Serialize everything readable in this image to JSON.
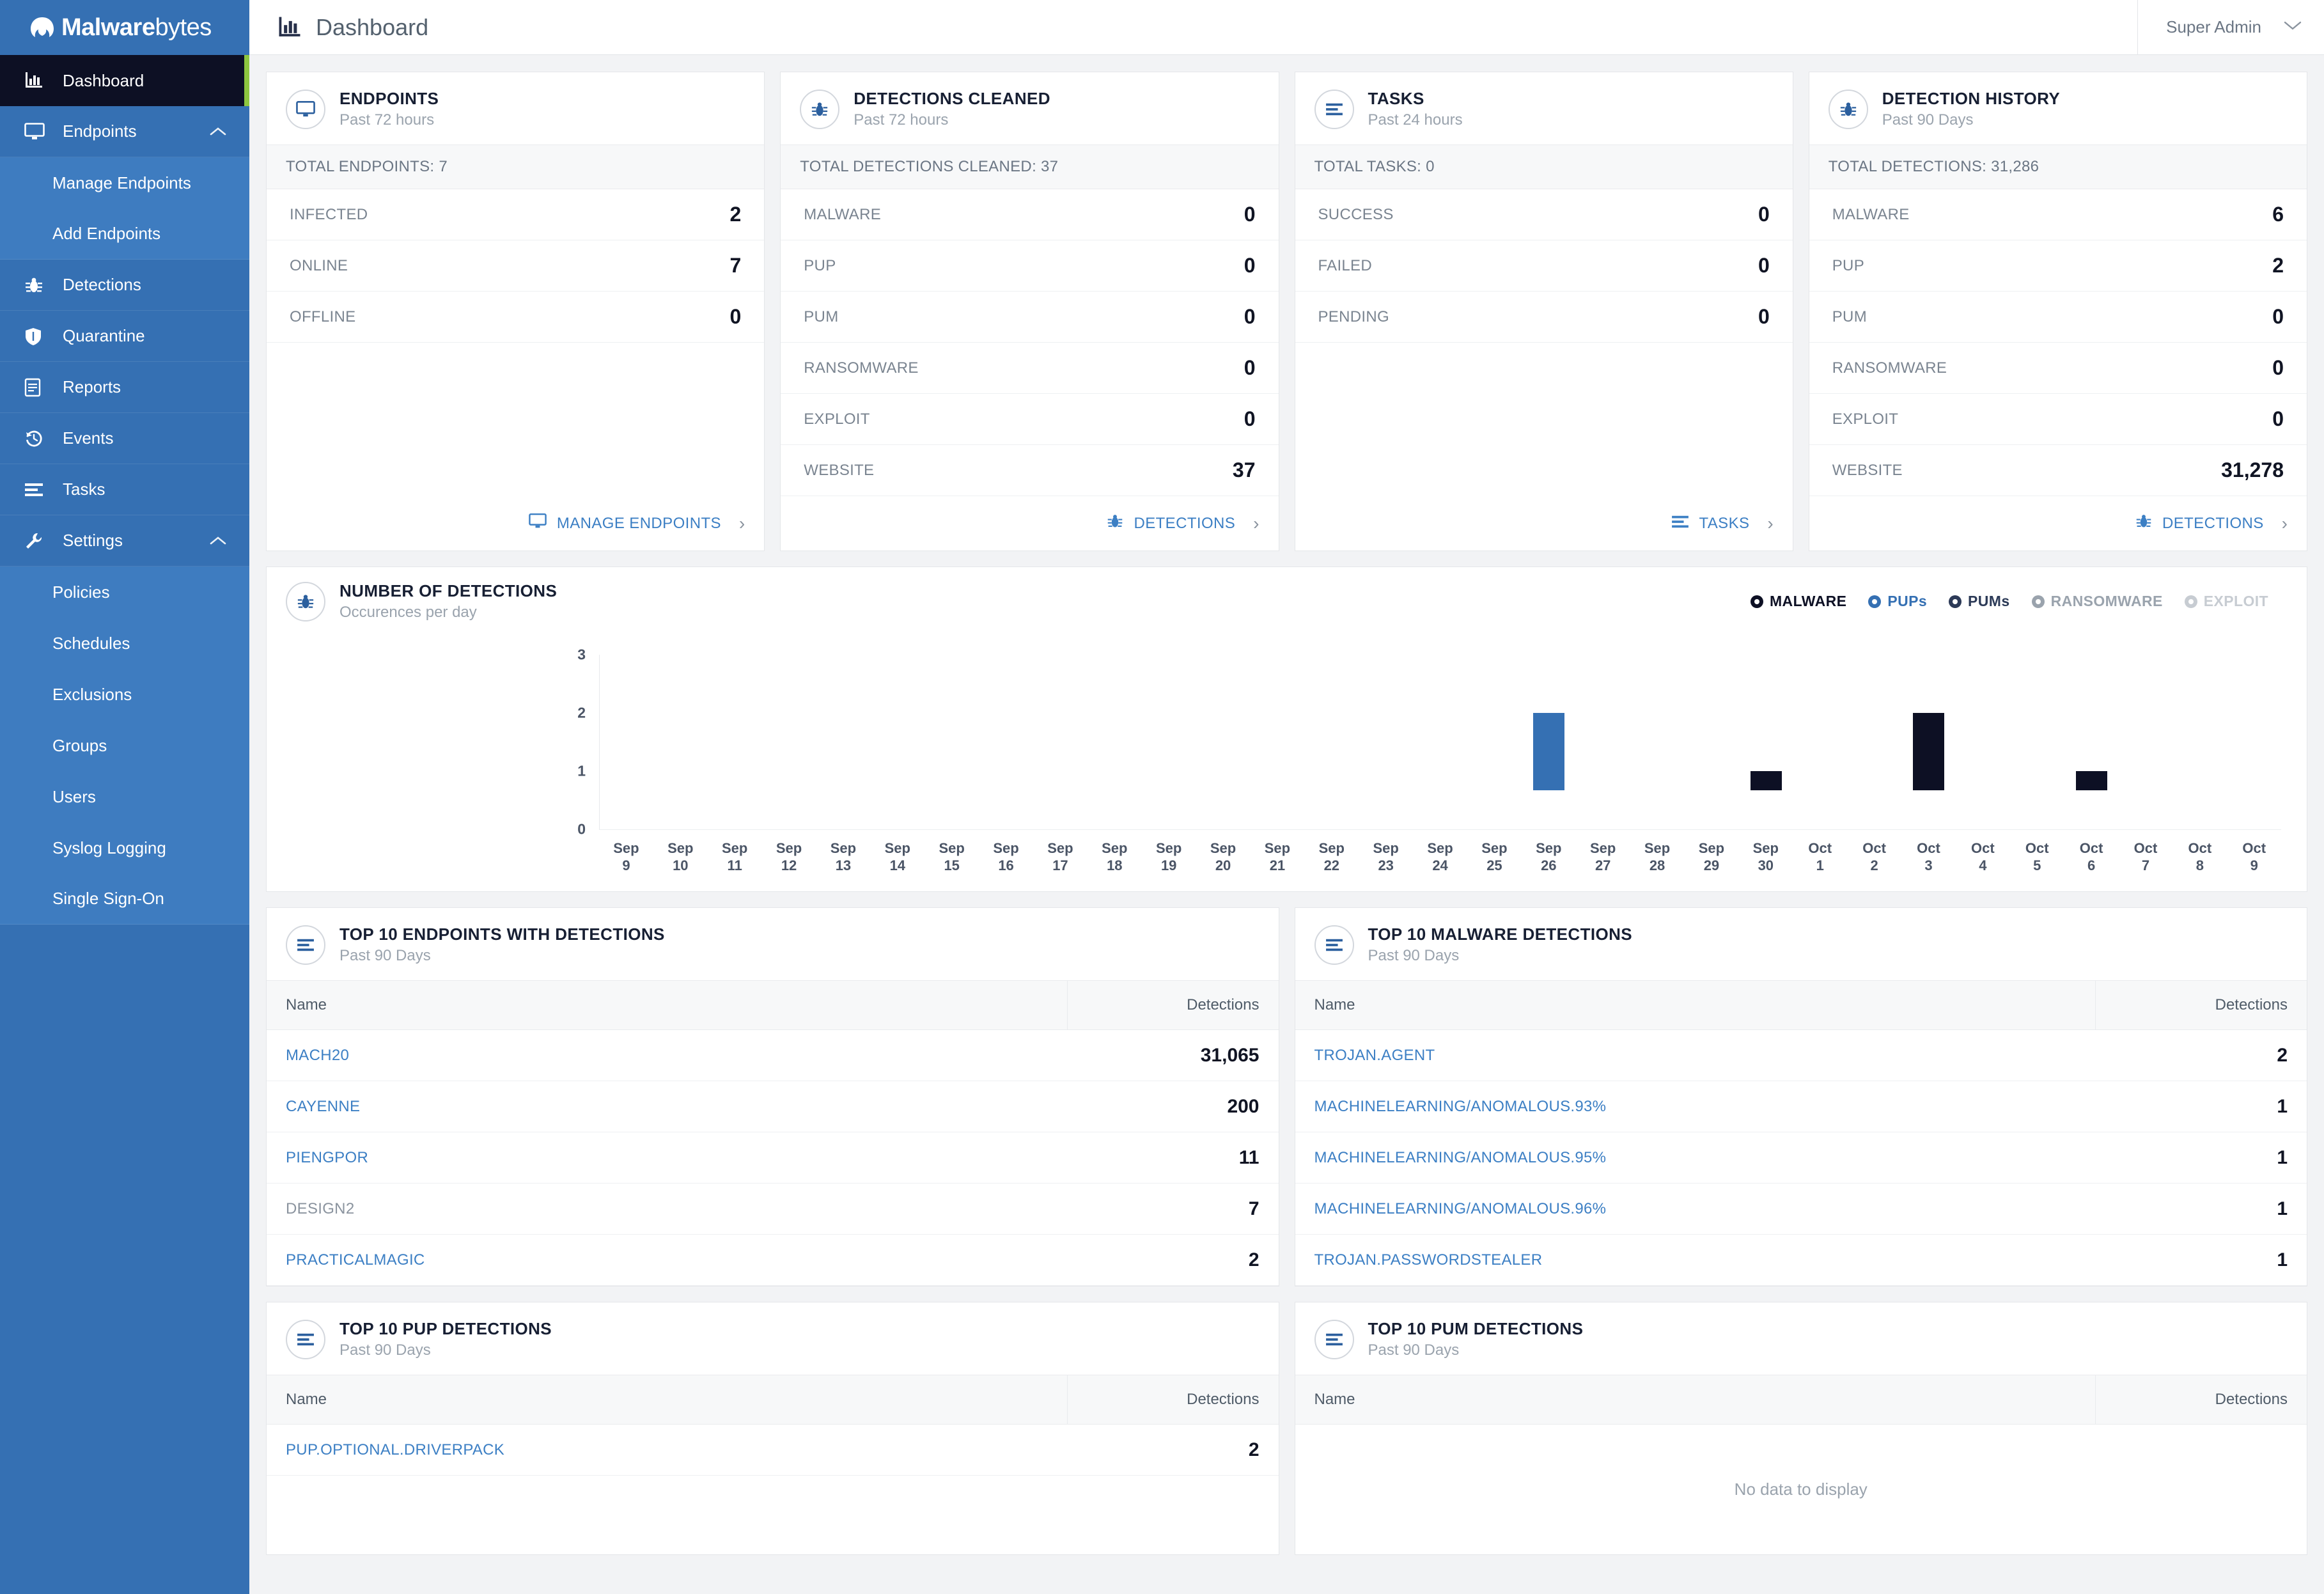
{
  "brand": {
    "name_bold": "Malware",
    "name_light": "bytes"
  },
  "sidebar": {
    "items": [
      {
        "label": "Dashboard",
        "icon": "bar-chart-icon",
        "active": true
      },
      {
        "label": "Endpoints",
        "icon": "monitor-icon",
        "expandable": true
      },
      {
        "label": "Manage Endpoints",
        "sub": true
      },
      {
        "label": "Add Endpoints",
        "sub": true
      },
      {
        "label": "Detections",
        "icon": "bug-icon"
      },
      {
        "label": "Quarantine",
        "icon": "shield-icon"
      },
      {
        "label": "Reports",
        "icon": "document-icon"
      },
      {
        "label": "Events",
        "icon": "history-icon"
      },
      {
        "label": "Tasks",
        "icon": "list-icon"
      },
      {
        "label": "Settings",
        "icon": "wrench-icon",
        "expandable": true
      },
      {
        "label": "Policies",
        "sub": true
      },
      {
        "label": "Schedules",
        "sub": true
      },
      {
        "label": "Exclusions",
        "sub": true
      },
      {
        "label": "Groups",
        "sub": true
      },
      {
        "label": "Users",
        "sub": true
      },
      {
        "label": "Syslog Logging",
        "sub": true
      },
      {
        "label": "Single Sign-On",
        "sub": true
      }
    ]
  },
  "topbar": {
    "title": "Dashboard",
    "title_icon": "bar-chart-icon",
    "user": "Super Admin",
    "user_chevron": "chevron-down-icon"
  },
  "cards": [
    {
      "title": "ENDPOINTS",
      "subtitle": "Past 72 hours",
      "icon": "monitor-icon",
      "total": "TOTAL ENDPOINTS: 7",
      "rows": [
        {
          "label": "INFECTED",
          "value": "2"
        },
        {
          "label": "ONLINE",
          "value": "7"
        },
        {
          "label": "OFFLINE",
          "value": "0"
        }
      ],
      "footer_label": "MANAGE ENDPOINTS",
      "footer_icon": "monitor-icon"
    },
    {
      "title": "DETECTIONS CLEANED",
      "subtitle": "Past 72 hours",
      "icon": "bug-icon",
      "total": "TOTAL DETECTIONS CLEANED: 37",
      "rows": [
        {
          "label": "MALWARE",
          "value": "0"
        },
        {
          "label": "PUP",
          "value": "0"
        },
        {
          "label": "PUM",
          "value": "0"
        },
        {
          "label": "RANSOMWARE",
          "value": "0"
        },
        {
          "label": "EXPLOIT",
          "value": "0"
        },
        {
          "label": "WEBSITE",
          "value": "37"
        }
      ],
      "footer_label": "DETECTIONS",
      "footer_icon": "bug-icon"
    },
    {
      "title": "TASKS",
      "subtitle": "Past 24 hours",
      "icon": "list-icon",
      "total": "TOTAL TASKS: 0",
      "rows": [
        {
          "label": "SUCCESS",
          "value": "0"
        },
        {
          "label": "FAILED",
          "value": "0"
        },
        {
          "label": "PENDING",
          "value": "0"
        }
      ],
      "footer_label": "TASKS",
      "footer_icon": "list-icon"
    },
    {
      "title": "DETECTION HISTORY",
      "subtitle": "Past 90 Days",
      "icon": "bug-icon",
      "total": "TOTAL DETECTIONS: 31,286",
      "rows": [
        {
          "label": "MALWARE",
          "value": "6"
        },
        {
          "label": "PUP",
          "value": "2"
        },
        {
          "label": "PUM",
          "value": "0"
        },
        {
          "label": "RANSOMWARE",
          "value": "0"
        },
        {
          "label": "EXPLOIT",
          "value": "0"
        },
        {
          "label": "WEBSITE",
          "value": "31,278"
        }
      ],
      "footer_label": "DETECTIONS",
      "footer_icon": "bug-icon"
    }
  ],
  "chart_panel": {
    "title": "NUMBER OF DETECTIONS",
    "subtitle": "Occurences per day",
    "icon": "bug-icon"
  },
  "chart_data": {
    "type": "bar",
    "title": "NUMBER OF DETECTIONS",
    "subtitle": "Occurences per day",
    "xlabel": "",
    "ylabel": "",
    "ylim": [
      0,
      3
    ],
    "yticks": [
      "0",
      "1",
      "2",
      "3"
    ],
    "grid": false,
    "legend_position": "top-right",
    "legend": [
      {
        "name": "MALWARE",
        "color": "#0d1024",
        "active": true
      },
      {
        "name": "PUPs",
        "color": "#3570b3",
        "active": true
      },
      {
        "name": "PUMs",
        "color": "#2c3a57",
        "active": true
      },
      {
        "name": "RANSOMWARE",
        "color": "#9aa3ad",
        "active": false
      },
      {
        "name": "EXPLOIT",
        "color": "#c7ccd2",
        "active": false
      }
    ],
    "categories": [
      "Sep 9",
      "Sep 10",
      "Sep 11",
      "Sep 12",
      "Sep 13",
      "Sep 14",
      "Sep 15",
      "Sep 16",
      "Sep 17",
      "Sep 18",
      "Sep 19",
      "Sep 20",
      "Sep 21",
      "Sep 22",
      "Sep 23",
      "Sep 24",
      "Sep 25",
      "Sep 26",
      "Sep 27",
      "Sep 28",
      "Sep 29",
      "Sep 30",
      "Oct 1",
      "Oct 2",
      "Oct 3",
      "Oct 4",
      "Oct 5",
      "Oct 6",
      "Oct 7",
      "Oct 8",
      "Oct 9"
    ],
    "series": [
      {
        "name": "MALWARE",
        "color": "#0d1024",
        "values": [
          0,
          0,
          0,
          0,
          0,
          0,
          0,
          0,
          0,
          0,
          0,
          0,
          0,
          0,
          0,
          0,
          0,
          0,
          0,
          0,
          0,
          1,
          0,
          0,
          2,
          0,
          0,
          1,
          0,
          0,
          0
        ]
      },
      {
        "name": "PUPs",
        "color": "#3570b3",
        "values": [
          0,
          0,
          0,
          0,
          0,
          0,
          0,
          0,
          0,
          0,
          0,
          0,
          0,
          0,
          0,
          0,
          0,
          2,
          0,
          0,
          0,
          0,
          0,
          0,
          0,
          0,
          0,
          0,
          0,
          0,
          0
        ]
      },
      {
        "name": "PUMs",
        "color": "#2c3a57",
        "values": [
          0,
          0,
          0,
          0,
          0,
          0,
          0,
          0,
          0,
          0,
          0,
          0,
          0,
          0,
          0,
          0,
          0,
          0,
          0,
          0,
          0,
          0,
          0,
          0,
          0,
          0,
          0,
          0,
          0,
          0,
          0
        ]
      },
      {
        "name": "RANSOMWARE",
        "color": "#9aa3ad",
        "values": [
          0,
          0,
          0,
          0,
          0,
          0,
          0,
          0,
          0,
          0,
          0,
          0,
          0,
          0,
          0,
          0,
          0,
          0,
          0,
          0,
          0,
          0,
          0,
          0,
          0,
          0,
          0,
          0,
          0,
          0,
          0
        ]
      },
      {
        "name": "EXPLOIT",
        "color": "#c7ccd2",
        "values": [
          0,
          0,
          0,
          0,
          0,
          0,
          0,
          0,
          0,
          0,
          0,
          0,
          0,
          0,
          0,
          0,
          0,
          0,
          0,
          0,
          0,
          0,
          0,
          0,
          0,
          0,
          0,
          0,
          0,
          0,
          0
        ]
      }
    ]
  },
  "panels": [
    {
      "title": "TOP 10 ENDPOINTS WITH DETECTIONS",
      "subtitle": "Past 90 Days",
      "icon": "list-icon",
      "columns": {
        "name": "Name",
        "detections": "Detections"
      },
      "rows": [
        {
          "name": "MACH20",
          "detections": "31,065",
          "link": true
        },
        {
          "name": "CAYENNE",
          "detections": "200",
          "link": true
        },
        {
          "name": "PIENGPOR",
          "detections": "11",
          "link": true
        },
        {
          "name": "DESIGN2",
          "detections": "7",
          "link": false
        },
        {
          "name": "PRACTICALMAGIC",
          "detections": "2",
          "link": true
        }
      ]
    },
    {
      "title": "TOP 10 MALWARE DETECTIONS",
      "subtitle": "Past 90 Days",
      "icon": "list-icon",
      "columns": {
        "name": "Name",
        "detections": "Detections"
      },
      "rows": [
        {
          "name": "TROJAN.AGENT",
          "detections": "2",
          "link": true
        },
        {
          "name": "MACHINELEARNING/ANOMALOUS.93%",
          "detections": "1",
          "link": true
        },
        {
          "name": "MACHINELEARNING/ANOMALOUS.95%",
          "detections": "1",
          "link": true
        },
        {
          "name": "MACHINELEARNING/ANOMALOUS.96%",
          "detections": "1",
          "link": true
        },
        {
          "name": "TROJAN.PASSWORDSTEALER",
          "detections": "1",
          "link": true
        }
      ]
    },
    {
      "title": "TOP 10 PUP DETECTIONS",
      "subtitle": "Past 90 Days",
      "icon": "list-icon",
      "columns": {
        "name": "Name",
        "detections": "Detections"
      },
      "rows": [
        {
          "name": "PUP.OPTIONAL.DRIVERPACK",
          "detections": "2",
          "link": true
        }
      ]
    },
    {
      "title": "TOP 10 PUM DETECTIONS",
      "subtitle": "Past 90 Days",
      "icon": "list-icon",
      "columns": {
        "name": "Name",
        "detections": "Detections"
      },
      "rows": [],
      "empty_text": "No data to display"
    }
  ],
  "colors": {
    "sidebar": "#3570b3",
    "sidebar_active": "#0d1024",
    "accent_green": "#8dc63f",
    "link_blue": "#3c7fc4",
    "bar_malware": "#0d1024",
    "bar_pup": "#3570b3"
  }
}
